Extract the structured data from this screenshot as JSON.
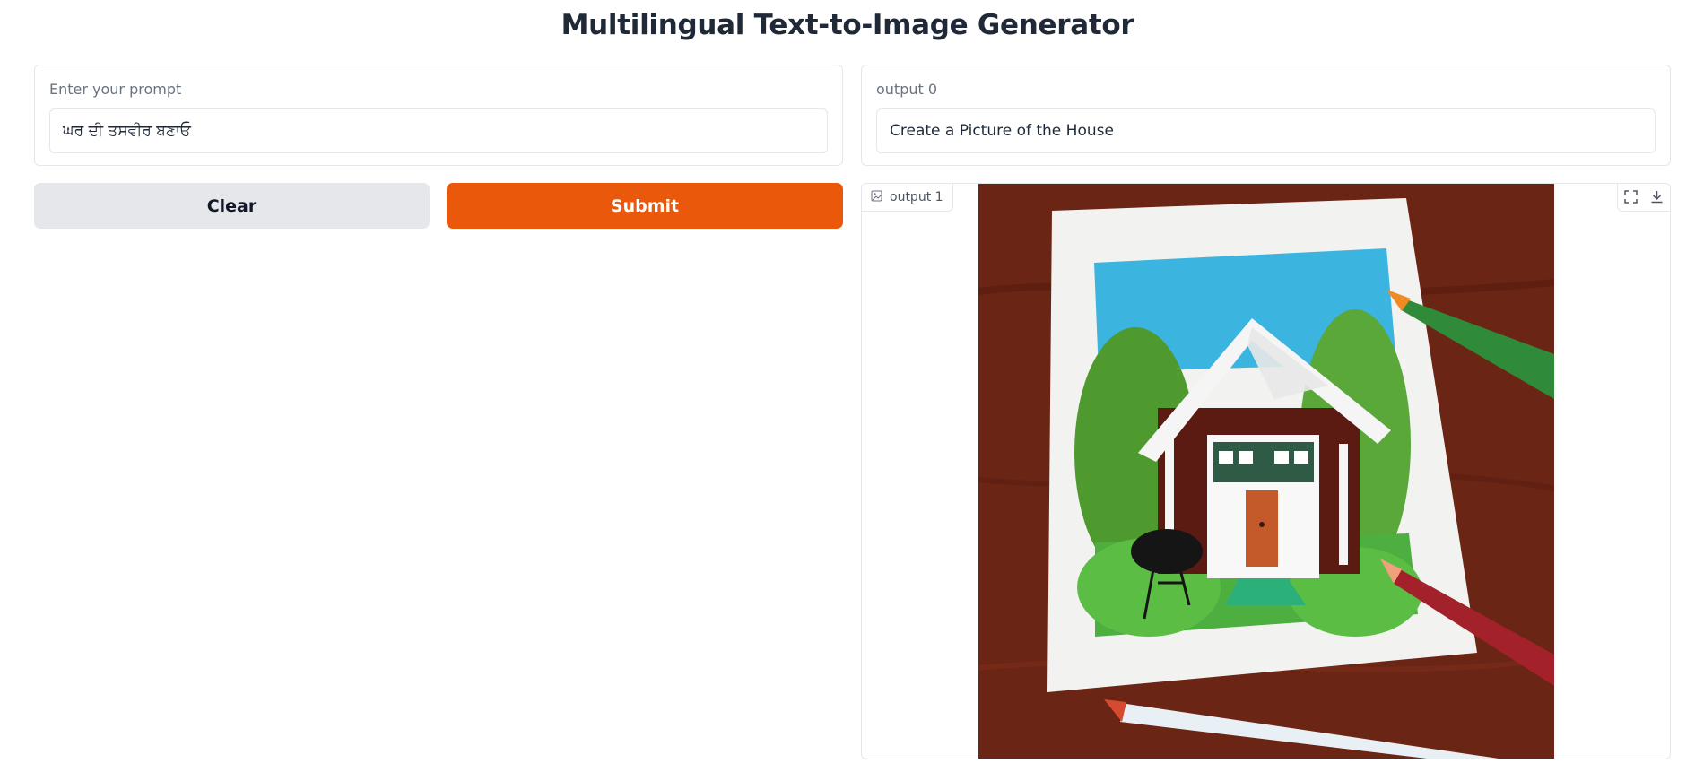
{
  "page": {
    "title": "Multilingual Text-to-Image Generator"
  },
  "input_panel": {
    "label": "Enter your prompt",
    "value": "ਘਰ ਦੀ ਤਸਵੀਰ ਬਣਾਓ"
  },
  "buttons": {
    "clear_label": "Clear",
    "submit_label": "Submit"
  },
  "output_text": {
    "label": "output 0",
    "value": "Create a Picture of the House"
  },
  "output_image": {
    "label": "output 1",
    "icons": [
      "image-icon",
      "fullscreen-icon",
      "download-icon"
    ],
    "image_subject": "paper-craft-house-with-colored-pencils"
  },
  "colors": {
    "accent": "#ea580c",
    "secondary_button": "#e5e7eb",
    "border": "#e5e7eb"
  }
}
